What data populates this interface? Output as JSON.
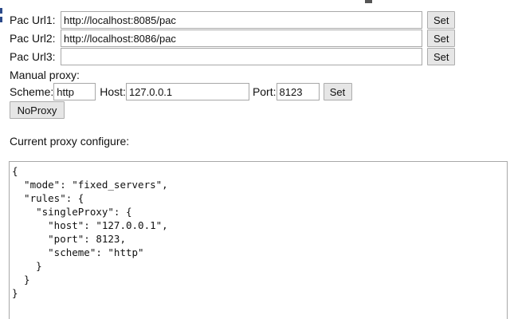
{
  "pac": [
    {
      "label": "Pac Url1:",
      "value": "http://localhost:8085/pac",
      "button": "Set"
    },
    {
      "label": "Pac Url2:",
      "value": "http://localhost:8086/pac",
      "button": "Set"
    },
    {
      "label": "Pac Url3:",
      "value": "",
      "button": "Set"
    }
  ],
  "manual": {
    "title": "Manual proxy:",
    "scheme_label": "Scheme:",
    "scheme_value": "http",
    "host_label": "Host:",
    "host_value": "127.0.0.1",
    "port_label": "Port:",
    "port_value": "8123",
    "set_label": "Set",
    "noproxy_label": "NoProxy"
  },
  "current": {
    "title": "Current proxy configure:",
    "config_text": "{\n  \"mode\": \"fixed_servers\",\n  \"rules\": {\n    \"singleProxy\": {\n      \"host\": \"127.0.0.1\",\n      \"port\": 8123,\n      \"scheme\": \"http\"\n    }\n  }\n}"
  }
}
